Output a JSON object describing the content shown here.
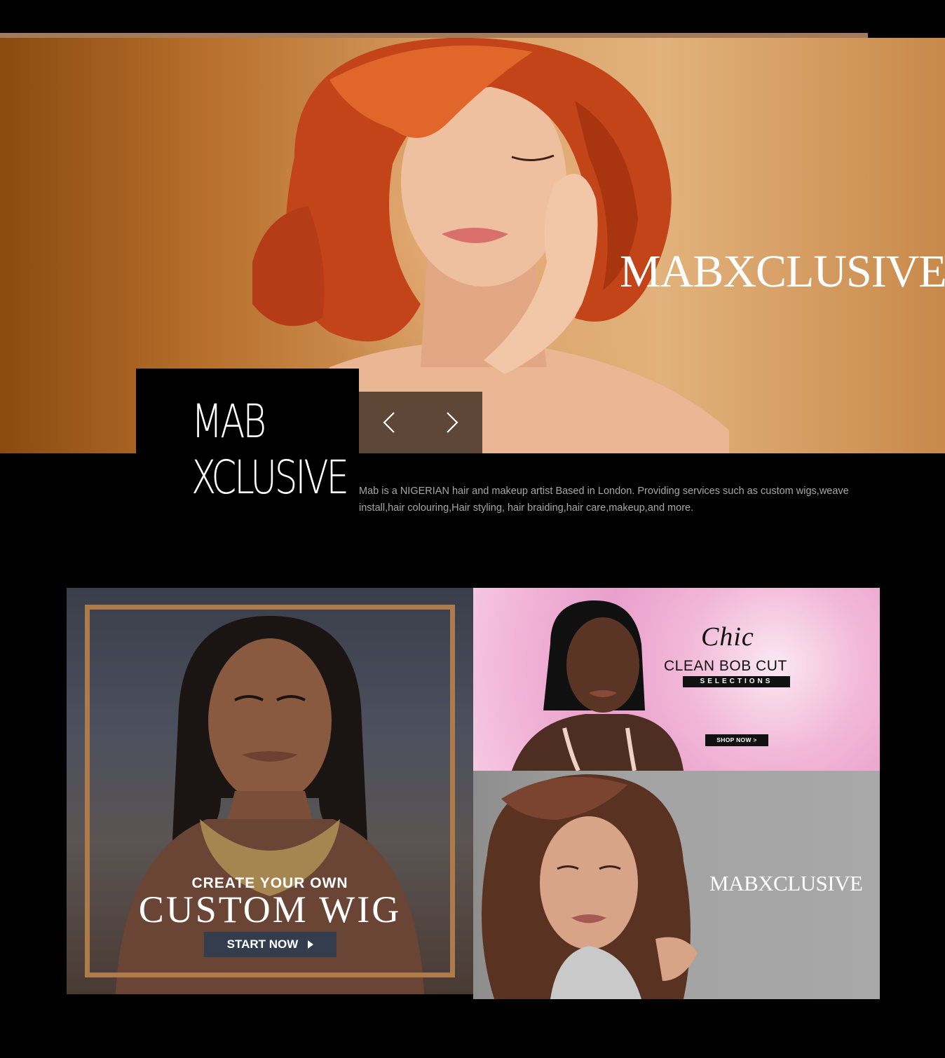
{
  "hero": {
    "brand": "MABXCLUSIVE",
    "logo": {
      "line1": "MAB",
      "line2": "XCLUSIVE"
    },
    "nav": {
      "prev_icon": "chevron-left-icon",
      "next_icon": "chevron-right-icon"
    }
  },
  "about": {
    "text": "Mab is a NIGERIAN hair and makeup artist Based in London. Providing services such as custom wigs,weave install,hair colouring,Hair styling, hair braiding,hair care,makeup,and more."
  },
  "promos": {
    "custom_wig": {
      "subtitle": "CREATE YOUR OWN",
      "title": "CUSTOM WIG",
      "button_label": "START NOW"
    },
    "bob_cut": {
      "script": "Chic",
      "title": "CLEAN BOB CUT",
      "tag": "SELECTIONS",
      "button_label": "SHOP NOW  >"
    },
    "brand_tile": {
      "brand": "MABXCLUSIVE"
    }
  },
  "colors": {
    "background": "#000000",
    "hero_accent": "#a47c5a",
    "frame_gold": "#b07b4a",
    "button_navy": "#333d4e",
    "body_text": "#a7a7a7"
  }
}
